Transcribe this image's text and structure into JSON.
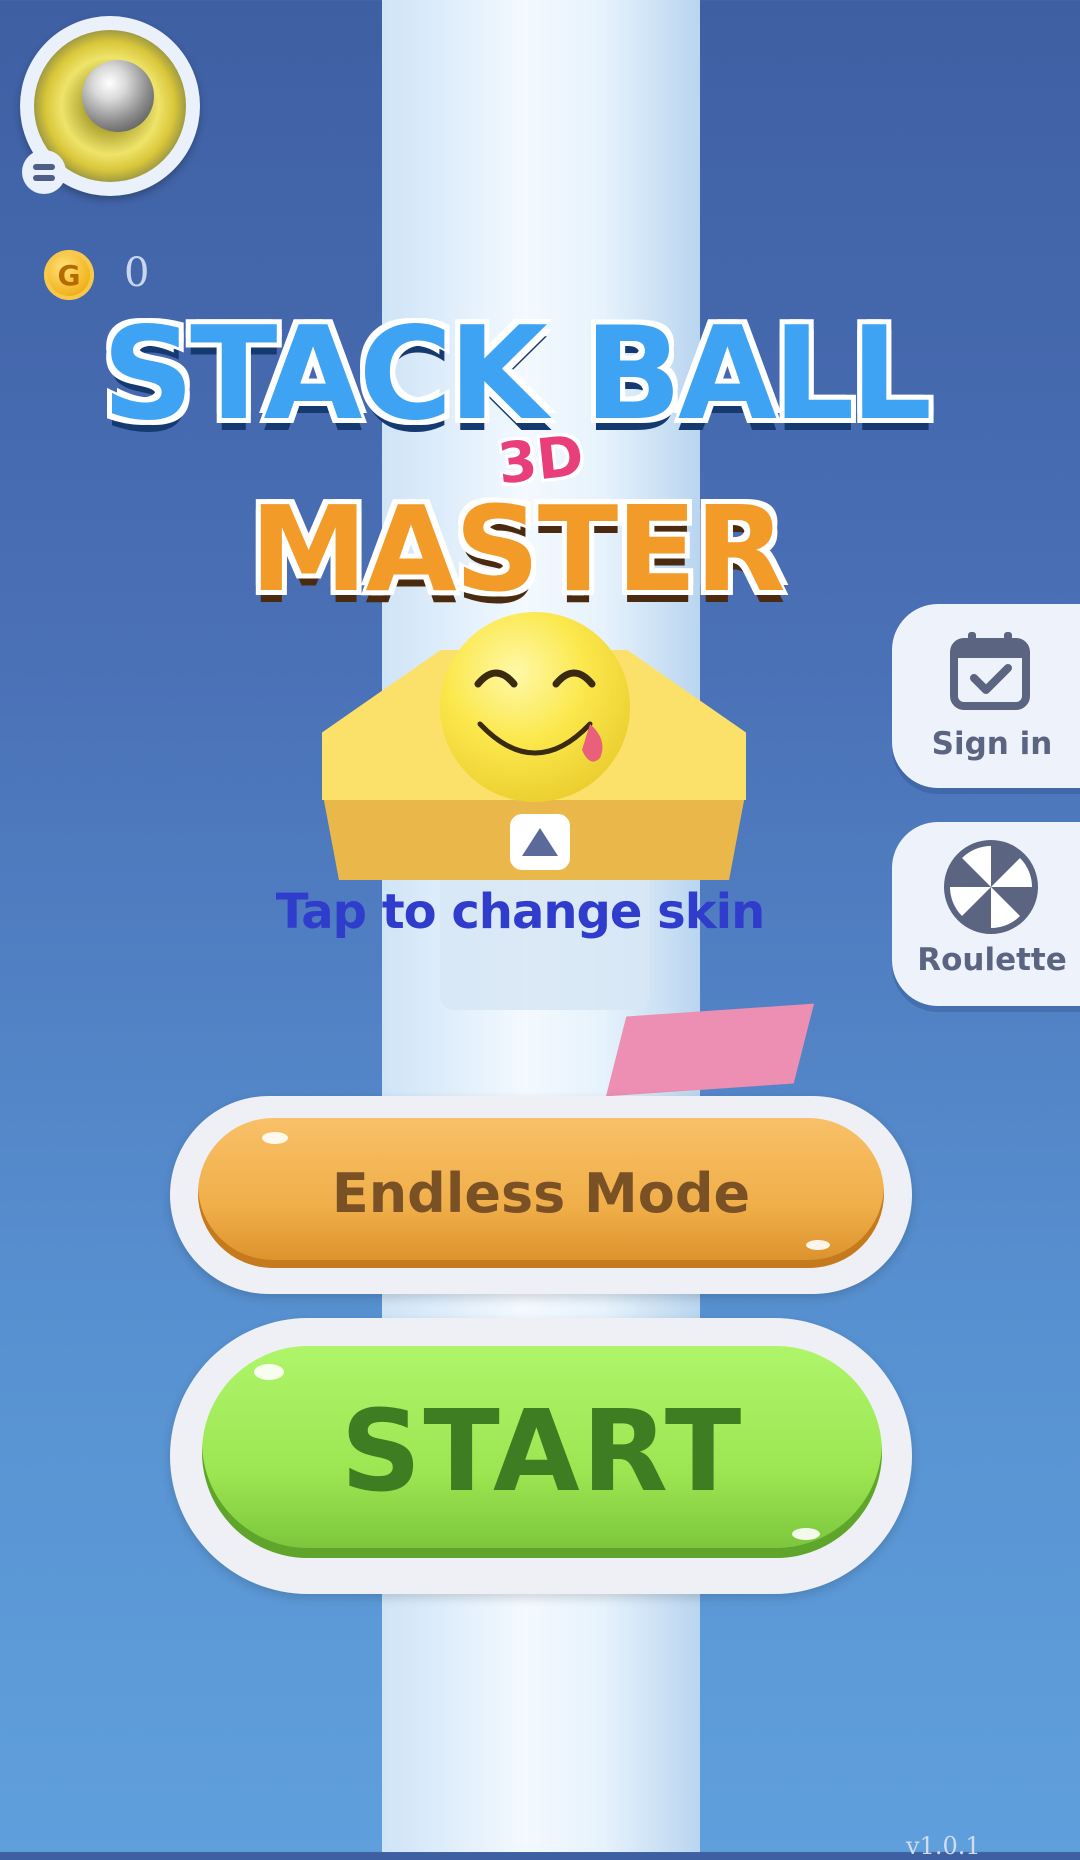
{
  "coins": {
    "count": "0",
    "icon_letter": "G"
  },
  "logo": {
    "line1": "STACK BALL",
    "badge": "3D",
    "line2": "MASTER"
  },
  "skin": {
    "hint": "Tap to change skin"
  },
  "side_buttons": {
    "sign_in": "Sign in",
    "roulette": "Roulette"
  },
  "modes": {
    "endless": "Endless Mode",
    "start": "START"
  },
  "version": "v1.0.1",
  "colors": {
    "start_green": "#9ce652",
    "endless_orange": "#f0ae48",
    "hint_blue": "#2f3ccc",
    "background_blue": "#4a70b6"
  },
  "icons": [
    "menu-icon",
    "coin-icon",
    "calendar-check-icon",
    "roulette-wheel-icon",
    "up-arrow-icon"
  ]
}
